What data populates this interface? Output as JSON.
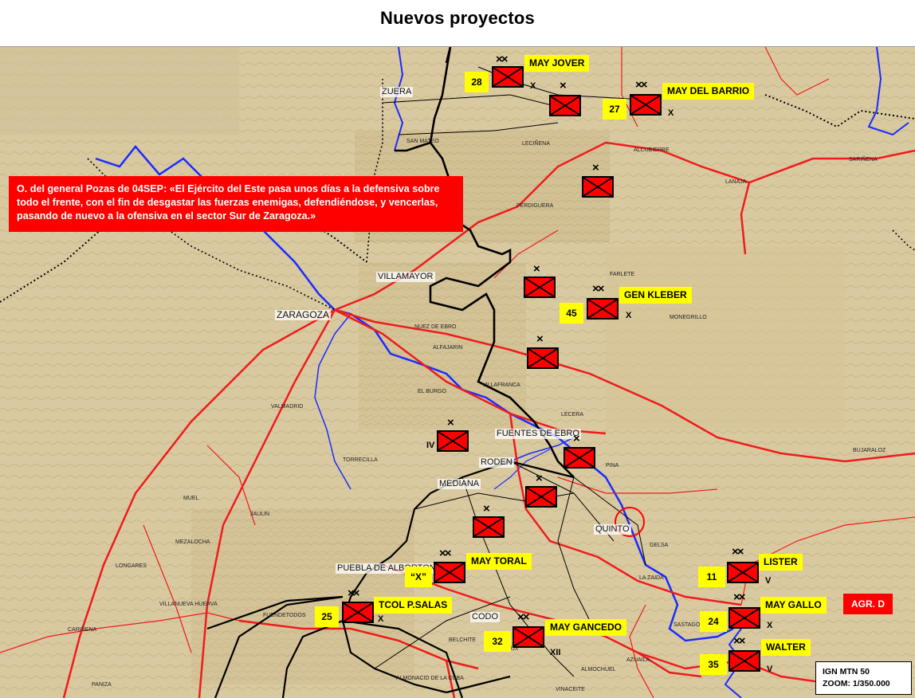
{
  "title": "Nuevos proyectos",
  "order_text": "O. del general Pozas de 04SEP: «El Ejército del Este pasa unos días a la defensiva sobre todo el frente, con el fin de desgastar las fuerzas enemigas, defendiéndose, y vencerlas, pasando de nuevo a la ofensiva en el sector Sur de Zaragoza.»",
  "agrupacion": "AGR. D",
  "scale_box": {
    "line1": "IGN MTN 50",
    "line2": "ZOOM: 1/350.000"
  },
  "colors": {
    "unit_fill": "#ff0000",
    "label_bg": "#ffff00",
    "front_line": "#000000",
    "road": "#ee1c1c",
    "river": "#1a2cff",
    "map_base": "#d8c9a0"
  },
  "icons": {
    "unit_symbol": "infantry-unit-icon",
    "quinto_marker": "circle-marker-icon"
  },
  "units": {
    "u28": {
      "num": "28",
      "echelon": "××",
      "name": "MAY JOVER",
      "size": "X"
    },
    "u27": {
      "num": "27",
      "echelon": "××",
      "name": "MAY DEL BARRIO",
      "size": "X"
    },
    "u45": {
      "num": "45",
      "echelon": "××",
      "name": "GEN KLEBER",
      "size": "X"
    },
    "uX": {
      "num": "“X”",
      "echelon": "××",
      "name": "MAY TORAL"
    },
    "u25": {
      "num": "25",
      "echelon": "××",
      "name": "TCOL P.SALAS",
      "size": "X"
    },
    "u32": {
      "num": "32",
      "echelon": "××",
      "name": "MAY  GANCEDO",
      "size": "XII"
    },
    "u11": {
      "num": "11",
      "echelon": "××",
      "name": "LISTER",
      "size": "V"
    },
    "u24": {
      "num": "24",
      "echelon": "××",
      "name": "MAY GALLO",
      "size": "X"
    },
    "u35": {
      "num": "35",
      "echelon": "××",
      "name": "WALTER",
      "size": "V"
    },
    "b1": {
      "echelon": "×"
    },
    "b2": {
      "echelon": "×"
    },
    "b3": {
      "echelon": "×"
    },
    "b4": {
      "echelon": "×"
    },
    "b5": {
      "echelon": "×",
      "size": "IV"
    },
    "b6": {
      "echelon": "×"
    },
    "b7": {
      "echelon": "×"
    },
    "b8": {
      "echelon": "×"
    }
  },
  "towns": {
    "zaragoza": "ZARAGOZA",
    "villamayor": "VILLAMAYOR",
    "fuentes": "FUENTES DE EBRO",
    "quinto": "QUINTO",
    "zuera": "ZUERA",
    "puebla": "PUEBLA DE ALBORTON",
    "codo": "CODO",
    "roden": "RODEN",
    "mediana": "MEDIANA"
  },
  "places": [
    "SAN MATEO",
    "LECIÑENA",
    "PERDIGUERA",
    "FARLETE",
    "MONEGRILLO",
    "ALCUBIERRE",
    "LANAJA",
    "SARIÑENA",
    "ALFAJARIN",
    "NUEZ DE EBRO",
    "VILLAFRANCA",
    "EL BURGO",
    "TORRECILLA",
    "JAULIN",
    "MEZALOCHA",
    "VILLANUEVA HUERVA",
    "LONGARES",
    "CARIÑENA",
    "PANIZA",
    "BELCHITE",
    "ALMONACID DE LA CUBA",
    "VINACEITE",
    "LETUX",
    "AZUAILA",
    "SASTAGO",
    "VALMADRID",
    "FUENDETODOS",
    "MUEL",
    "JAULIN",
    "PINA",
    "GELSA",
    "BUJARALOZ",
    "ALMOCHUEL",
    "LA ZAIDA",
    "CODO",
    "LECERA"
  ]
}
